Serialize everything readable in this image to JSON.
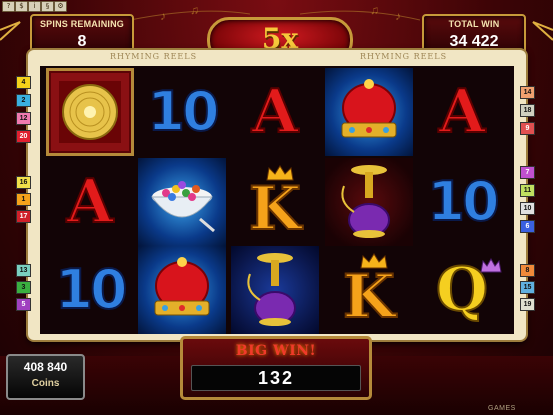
{
  "top_icons": [
    "?",
    "$",
    "i",
    "§",
    "⚙"
  ],
  "header": {
    "spins_label": "SPINS REMAINING",
    "spins_value": "8",
    "multiplier": "5x",
    "total_win_label": "TOTAL WIN",
    "total_win_value": "34 422",
    "book_title_left": "RHYMING REELS",
    "book_title_right": "RHYMING REELS"
  },
  "paylines_left": [
    "4",
    "2",
    "12",
    "20",
    "16",
    "1",
    "17",
    "13",
    "3",
    "5"
  ],
  "paylines_right": [
    "14",
    "18",
    "9",
    "7",
    "11",
    "10",
    "6",
    "8",
    "15",
    "19"
  ],
  "reels": [
    [
      "gold-record",
      "ace",
      "ten"
    ],
    [
      "ten",
      "cereal-bowl",
      "crown"
    ],
    [
      "ace",
      "king",
      "hookah"
    ],
    [
      "crown",
      "hookah",
      "king"
    ],
    [
      "ace",
      "ten",
      "queen"
    ]
  ],
  "symbol_text": {
    "ace": "A",
    "king": "K",
    "queen": "Q",
    "ten": "10"
  },
  "bottom": {
    "coins_value": "408 840",
    "coins_label": "Coins",
    "big_win_label": "BIG WIN!",
    "big_win_value": "132",
    "games_label": "GAMES"
  }
}
